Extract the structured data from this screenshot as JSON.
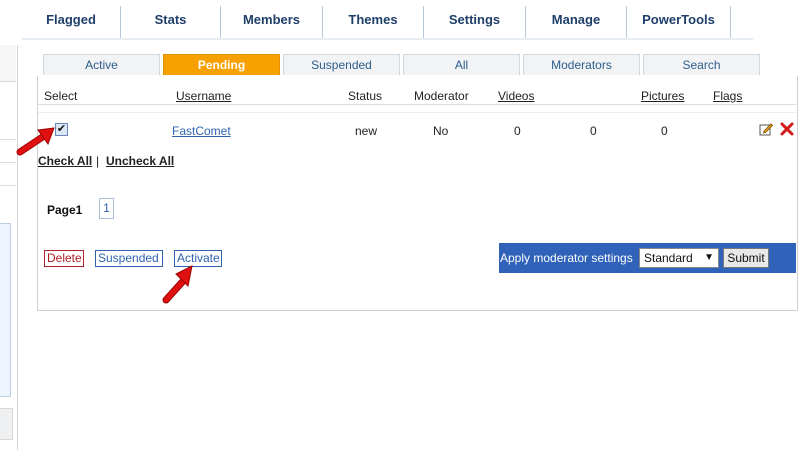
{
  "nav": {
    "items": [
      "Flagged",
      "Stats",
      "Members",
      "Themes",
      "Settings",
      "Manage",
      "PowerTools"
    ]
  },
  "tabs": {
    "active": "Active",
    "pending": "Pending",
    "suspended": "Suspended",
    "all": "All",
    "moderators": "Moderators",
    "search": "Search"
  },
  "table": {
    "headers": {
      "select": "Select",
      "username": "Username",
      "status": "Status",
      "moderator": "Moderator",
      "videos": "Videos",
      "pictures": "Pictures",
      "flags": "Flags"
    },
    "row": {
      "username": "FastComet",
      "status": "new",
      "moderator": "No",
      "videos": "0",
      "col5": "0",
      "pictures": "0",
      "checked": true
    }
  },
  "actions": {
    "check_all": "Check All",
    "divider": "|",
    "uncheck_all": "Uncheck All",
    "delete": "Delete",
    "suspended": "Suspended",
    "activate": "Activate"
  },
  "pagination": {
    "label": "Page1",
    "current": "1"
  },
  "moderator_settings": {
    "label": "Apply moderator settings",
    "selected": "Standard",
    "submit": "Submit"
  },
  "colors": {
    "tab_active": "#f6a100",
    "link": "#2f62b0",
    "nav_text": "#1f3f6a",
    "mod_bar": "#2f62b8",
    "delete": "#b0202a",
    "annotation_arrow": "#e01010"
  },
  "icons": {
    "edit": "edit-icon",
    "delete": "delete-x-icon",
    "annotation": "red-arrow-icon"
  }
}
